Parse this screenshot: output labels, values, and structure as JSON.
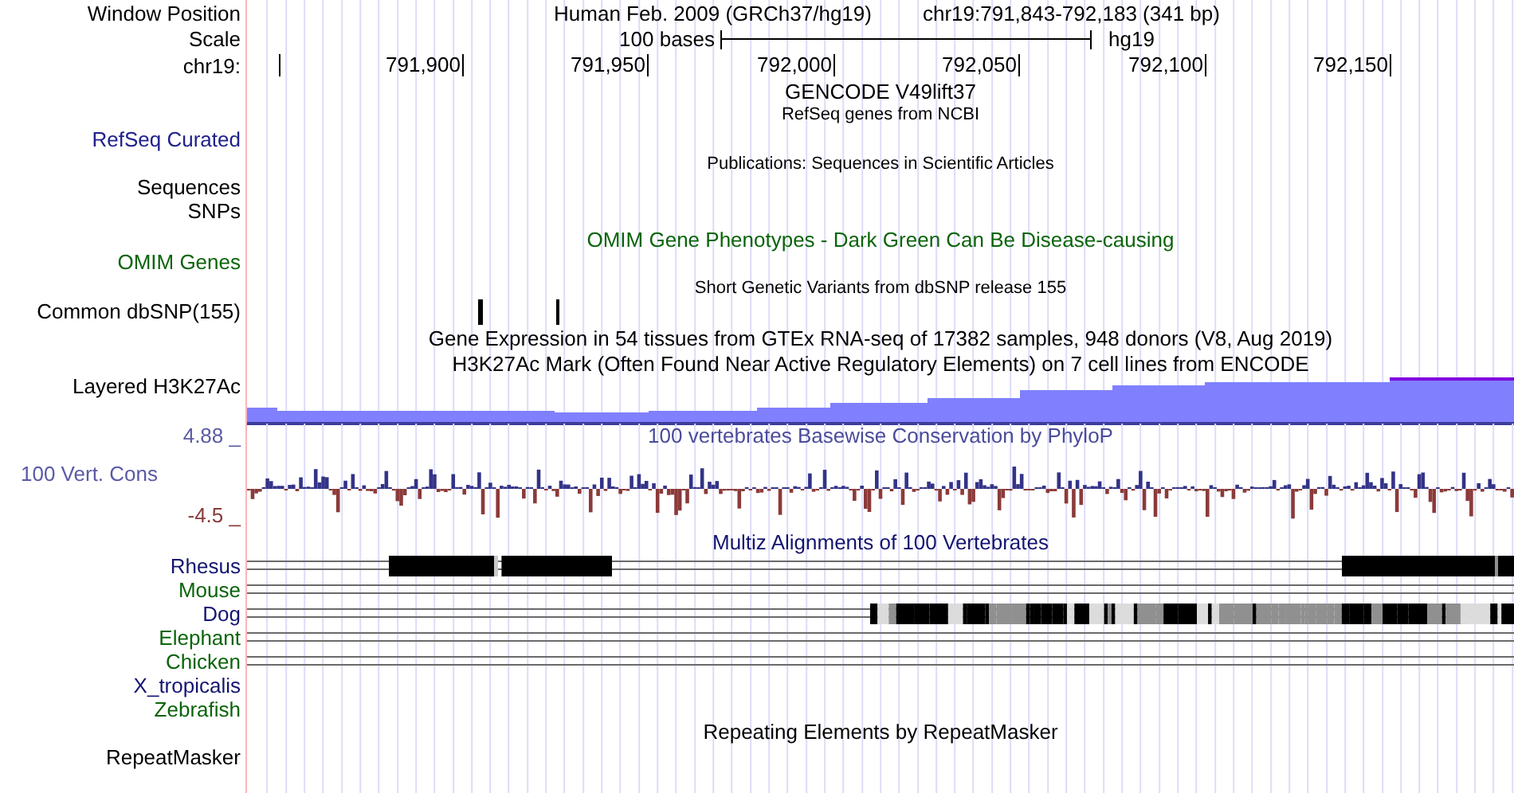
{
  "header": {
    "label": "Window Position",
    "title": "Human Feb. 2009 (GRCh37/hg19)",
    "position": "chr19:791,843-792,183 (341 bp)"
  },
  "scale": {
    "label": "Scale",
    "length": "100 bases",
    "assembly": "hg19"
  },
  "ruler": {
    "label": "chr19:",
    "ticks": [
      "791,900",
      "791,950",
      "792,000",
      "792,050",
      "792,100",
      "792,150"
    ]
  },
  "tracks": [
    {
      "kind": "title",
      "title": {
        "text": "GENCODE V49lift37",
        "color": "#000000"
      }
    },
    {
      "kind": "genes",
      "title": {
        "text": "RefSeq genes from NCBI",
        "color": "#000000"
      },
      "labels": [
        {
          "text": "RefSeq Curated",
          "color": "#20208c"
        }
      ]
    },
    {
      "kind": "publications",
      "title": {
        "text": "Publications: Sequences in Scientific Articles",
        "color": "#000000"
      },
      "labels": [
        {
          "text": "Sequences",
          "color": "#000000"
        },
        {
          "text": "SNPs",
          "color": "#000000"
        }
      ]
    },
    {
      "kind": "omim",
      "title": {
        "text": "OMIM Gene Phenotypes - Dark Green Can Be Disease-causing",
        "color": "#0a640a"
      },
      "labels": [
        {
          "text": "OMIM Genes",
          "color": "#0a640a"
        }
      ]
    },
    {
      "kind": "snp",
      "title": {
        "text": "Short Genetic Variants from dbSNP release 155",
        "color": "#000000"
      },
      "labels": [
        {
          "text": "Common dbSNP(155)",
          "color": "#000000"
        }
      ]
    },
    {
      "kind": "title",
      "title": {
        "text": "Gene Expression in 54 tissues from GTEx RNA-seq of 17382 samples, 948 donors (V8, Aug 2019)",
        "color": "#000000"
      }
    },
    {
      "kind": "signal",
      "title": {
        "text": "H3K27Ac Mark (Often Found Near Active Regulatory Elements) on 7 cell lines from ENCODE",
        "color": "#000000"
      },
      "labels": [
        {
          "text": "Layered H3K27Ac",
          "color": "#000000"
        }
      ]
    },
    {
      "kind": "conservation",
      "title": {
        "text": "100 vertebrates Basewise Conservation by PhyloP",
        "color": "#4b4b9b"
      },
      "labels": [
        {
          "text": "4.88 _",
          "color": "#5a5aa6"
        },
        {
          "text": "100 Vert. Cons",
          "color": "#5a5aa6"
        },
        {
          "text": "-4.5 _",
          "color": "#8a3a3a"
        }
      ]
    },
    {
      "kind": "alignment",
      "title": {
        "text": "Multiz Alignments of 100 Vertebrates",
        "color": "#141470"
      },
      "species": [
        {
          "name": "Rhesus",
          "color": "#141470",
          "aligned": true
        },
        {
          "name": "Mouse",
          "color": "#0a640a",
          "aligned": true
        },
        {
          "name": "Dog",
          "color": "#141470",
          "aligned": true
        },
        {
          "name": "Elephant",
          "color": "#0a640a",
          "aligned": true
        },
        {
          "name": "Chicken",
          "color": "#0a640a",
          "aligned": true
        },
        {
          "name": "X_tropicalis",
          "color": "#141470",
          "aligned": false
        },
        {
          "name": "Zebrafish",
          "color": "#0a640a",
          "aligned": false
        }
      ]
    },
    {
      "kind": "repeats",
      "title": {
        "text": "Repeating Elements by RepeatMasker",
        "color": "#000000"
      },
      "labels": [
        {
          "text": "RepeatMasker",
          "color": "#000000"
        }
      ]
    }
  ]
}
